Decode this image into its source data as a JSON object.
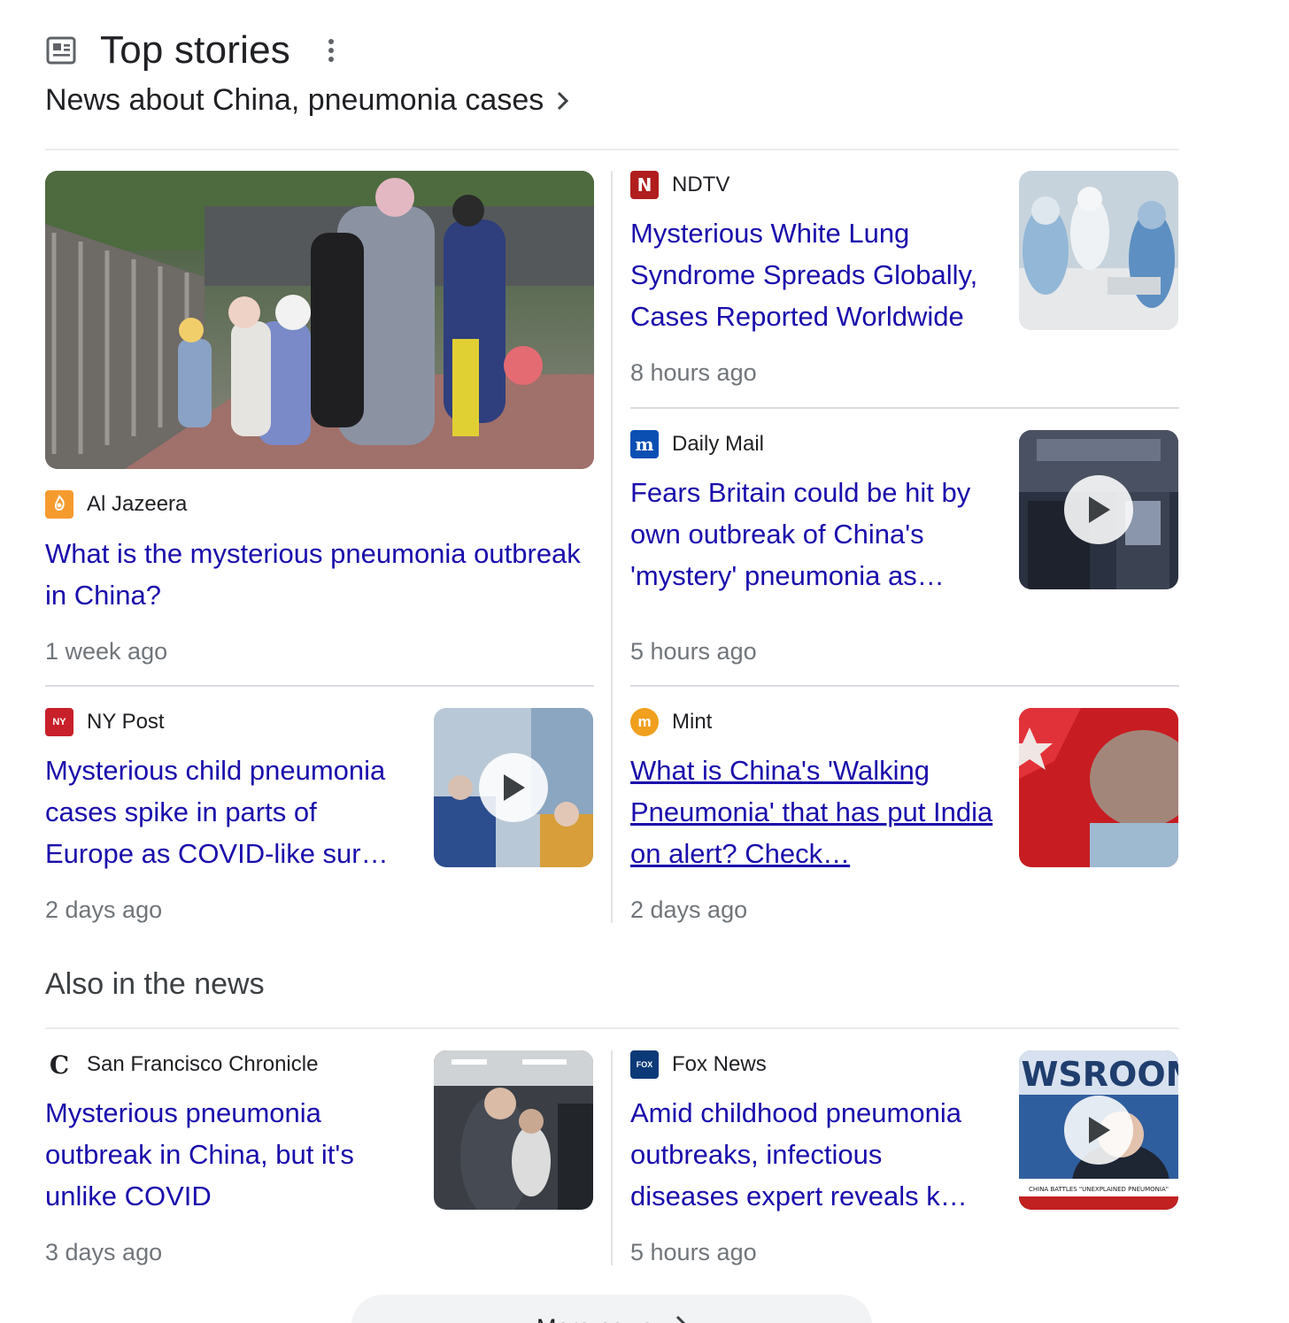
{
  "header": {
    "title": "Top stories",
    "subheader": "News about China, pneumonia cases"
  },
  "stories": [
    {
      "source": "Al Jazeera",
      "headline": "What is the mysterious pneumonia outbreak in China?",
      "time": "1 week ago",
      "has_video": false
    },
    {
      "source": "NDTV",
      "headline": "Mysterious White Lung Syndrome Spreads Globally, Cases Reported Worldwide",
      "time": "8 hours ago",
      "has_video": false
    },
    {
      "source": "Daily Mail",
      "headline": "Fears Britain could be hit by own outbreak of China's 'mystery' pneumonia as…",
      "time": "5 hours ago",
      "has_video": true
    },
    {
      "source": "NY Post",
      "headline": "Mysterious child pneumonia cases spike in parts of Europe as COVID-like sur…",
      "time": "2 days ago",
      "has_video": true
    },
    {
      "source": "Mint",
      "headline": "What is China's 'Walking Pneumonia' that has put India on alert? Check…",
      "time": "2 days ago",
      "has_video": false
    }
  ],
  "also_in_news": {
    "title": "Also in the news",
    "stories": [
      {
        "source": "San Francisco Chronicle",
        "headline": "Mysterious pneumonia outbreak in China, but it's unlike COVID",
        "time": "3 days ago",
        "has_video": false
      },
      {
        "source": "Fox News",
        "headline": "Amid childhood pneumonia outbreaks, infectious diseases expert reveals k…",
        "time": "5 hours ago",
        "has_video": true,
        "thumb_text": "CHINA BATTLES \"UNEXPLAINED PNEUMONIA\""
      }
    ]
  },
  "more_button": {
    "label": "More news"
  },
  "colors": {
    "link": "#1a0dab",
    "meta": "#70757a",
    "divider": "#dadce0"
  },
  "icons": {
    "header": "newspaper-icon",
    "menu": "more-vert-icon",
    "chevron": "chevron-right-icon",
    "play": "play-icon"
  }
}
